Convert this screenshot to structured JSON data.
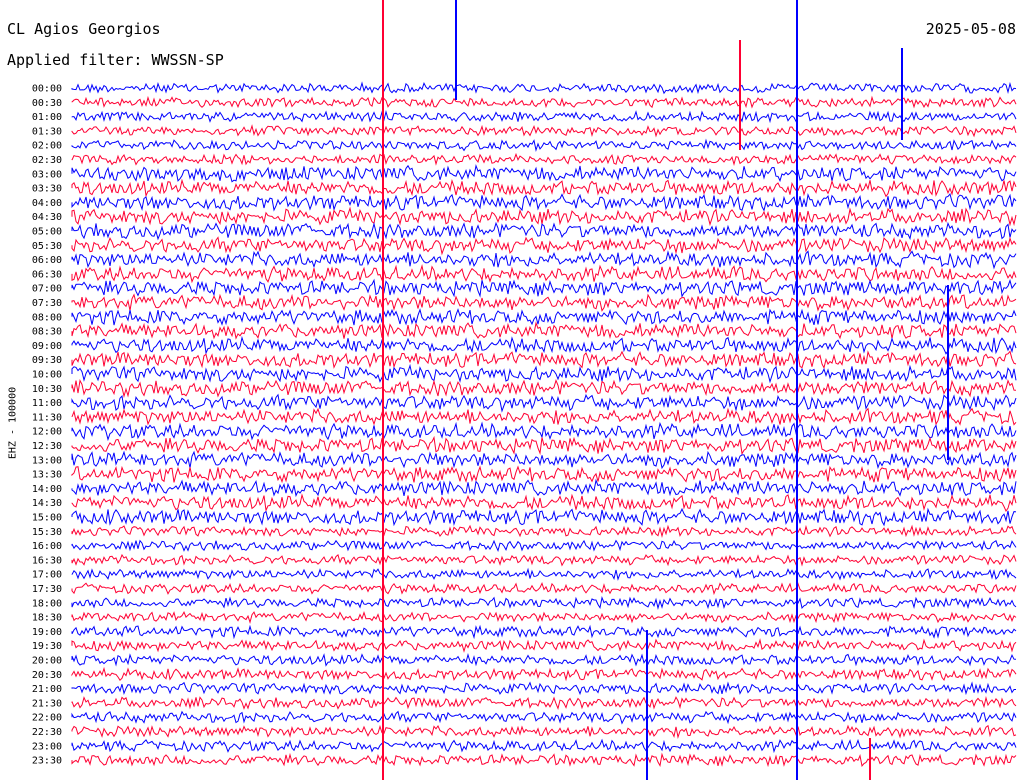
{
  "header": {
    "station": "CL Agios Georgios",
    "date": "2025-05-08",
    "filter": "Applied filter: WWSSN-SP"
  },
  "chart_data": {
    "type": "line",
    "title": "CL Agios Georgios",
    "ylabel": "EHZ - 100000",
    "colors": [
      "#0000ff",
      "#ff0033"
    ],
    "grid": false,
    "legend": "none",
    "tick_labels": [
      "00:00",
      "00:30",
      "01:00",
      "01:30",
      "02:00",
      "02:30",
      "03:00",
      "03:30",
      "04:00",
      "04:30",
      "05:00",
      "05:30",
      "06:00",
      "06:30",
      "07:00",
      "07:30",
      "08:00",
      "08:30",
      "09:00",
      "09:30",
      "10:00",
      "10:30",
      "11:00",
      "11:30",
      "12:00",
      "12:30",
      "13:00",
      "13:30",
      "14:00",
      "14:30",
      "15:00",
      "15:30",
      "16:00",
      "16:30",
      "17:00",
      "17:30",
      "18:00",
      "18:30",
      "19:00",
      "19:30",
      "20:00",
      "20:30",
      "21:00",
      "21:30",
      "22:00",
      "22:30",
      "23:00",
      "23:30"
    ]
  }
}
